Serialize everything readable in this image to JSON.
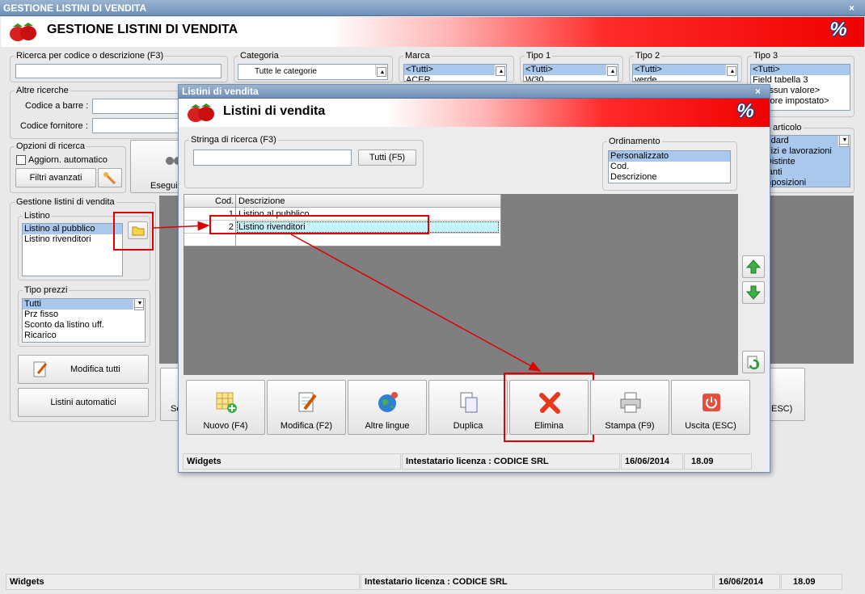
{
  "main": {
    "window_title": "GESTIONE LISTINI DI VENDITA",
    "banner_title": "GESTIONE LISTINI DI VENDITA",
    "close_glyph": "×",
    "pct_glyph": "%",
    "search": {
      "legend": "Ricerca per codice o descrizione (F3)",
      "value": ""
    },
    "categoria": {
      "legend": "Categoria",
      "item": "Tutte le categorie"
    },
    "marca": {
      "legend": "Marca",
      "items": [
        "<Tutti>",
        "ACER"
      ]
    },
    "tipo1": {
      "legend": "Tipo 1",
      "items": [
        "<Tutti>",
        "W30"
      ]
    },
    "tipo2": {
      "legend": "Tipo 2",
      "items": [
        "<Tutti>",
        "verde"
      ]
    },
    "tipo3": {
      "legend": "Tipo 3",
      "items": [
        "<Tutti>",
        "Field tabella 3",
        "<Nessun valore>",
        "<Valore impostato>"
      ]
    },
    "altre_ricerche": {
      "legend": "Altre ricerche",
      "barcode_label": "Codice a barre :",
      "fornitore_label": "Codice fornitore :"
    },
    "opzioni": {
      "legend": "Opzioni di ricerca",
      "auto_label": "Aggiorn. automatico",
      "filtri_label": "Filtri avanzati",
      "esegui_label": "Esegui"
    },
    "tipo_articolo": {
      "legend": "Tipo articolo",
      "items": [
        "Standard",
        "Servizi e lavorazioni",
        "Kit/Distinte",
        "Varianti",
        "Composizioni"
      ]
    },
    "gestione": {
      "legend": "Gestione listini di vendita"
    },
    "listino": {
      "legend": "Listino",
      "items": [
        "Listino al pubblico",
        "Listino rivenditori"
      ]
    },
    "tipo_prezzi": {
      "legend": "Tipo prezzi",
      "items": [
        "Tutti",
        "Prz fisso",
        "Sconto da listino uff.",
        "Ricarico"
      ]
    },
    "modifica_tutti_label": "Modifica tutti",
    "listini_automatici_label": "Listini automatici",
    "side_btn_left": "Se",
    "side_btn_right": "ESC)",
    "status": {
      "widgets": "Widgets",
      "licenza": "Intestatario licenza : CODICE SRL",
      "date": "16/06/2014",
      "time": "18.09"
    }
  },
  "dialog": {
    "title": "Listini di vendita",
    "banner_title": "Listini di vendita",
    "search_legend": "Stringa di ricerca (F3)",
    "search_value": "",
    "tutti_label": "Tutti (F5)",
    "ordinamento": {
      "legend": "Ordinamento",
      "items": [
        "Personalizzato",
        "Cod.",
        "Descrizione"
      ]
    },
    "grid": {
      "columns": [
        "Cod.",
        "Descrizione"
      ],
      "rows": [
        {
          "cod": "1",
          "desc": "Listino al pubblico"
        },
        {
          "cod": "2",
          "desc": "Listino rivenditori"
        }
      ]
    },
    "buttons": {
      "nuovo": "Nuovo (F4)",
      "modifica": "Modifica (F2)",
      "lingue": "Altre lingue",
      "duplica": "Duplica",
      "elimina": "Elimina",
      "stampa": "Stampa (F9)",
      "uscita": "Uscita (ESC)"
    },
    "status": {
      "widgets": "Widgets",
      "licenza": "Intestatario licenza : CODICE SRL",
      "date": "16/06/2014",
      "time": "18.09"
    }
  },
  "colors": {
    "accent_red": "#e00000",
    "selection": "#a9c8ec",
    "grid_grey": "#7f7f7f"
  }
}
